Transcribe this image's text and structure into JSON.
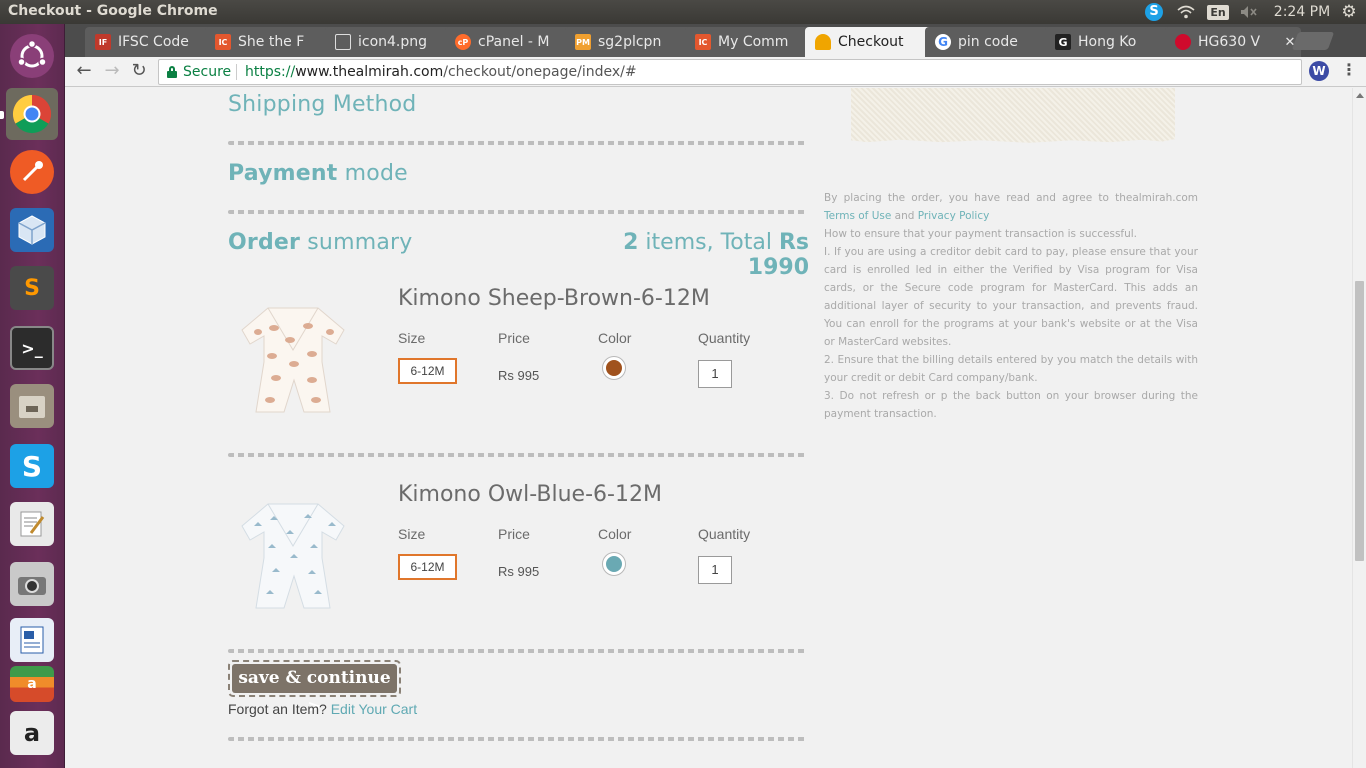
{
  "window": {
    "title": "Checkout - Google Chrome"
  },
  "tray": {
    "skype": "S",
    "lang": "En",
    "clock": "2:24 PM"
  },
  "tabs": [
    {
      "label": "IFSC Code",
      "favicon": "IFSC EPS",
      "color": "#c0392b"
    },
    {
      "label": "She the F",
      "favicon": "ICON",
      "color": "#e4572e"
    },
    {
      "label": "icon4.png",
      "favicon": "doc",
      "color": "#888888"
    },
    {
      "label": "cPanel - M",
      "favicon": "cP",
      "color": "#ff6c2c"
    },
    {
      "label": "sg2plcpn",
      "favicon": "PMA",
      "color": "#f0a030"
    },
    {
      "label": "My Comm",
      "favicon": "ICON",
      "color": "#e4572e"
    },
    {
      "label": "Checkout",
      "favicon": "almirah",
      "color": "#f0a500"
    },
    {
      "label": "pin code",
      "favicon": "G",
      "color": "#4285f4"
    },
    {
      "label": "Hong Ko",
      "favicon": "G",
      "color": "#222222"
    },
    {
      "label": "HG630 V",
      "favicon": "huawei",
      "color": "#cf0a2c"
    }
  ],
  "omnibox": {
    "secure_label": "Secure",
    "url_scheme": "https://",
    "url_host": "www.thealmirah.com",
    "url_path": "/checkout/onepage/index/#"
  },
  "checkout": {
    "shipping_method": "Shipping Method",
    "payment_bold": "Payment",
    "payment_rest": " mode",
    "order_bold": "Order",
    "order_rest": " summary",
    "total_count": "2",
    "total_mid": " items, Total ",
    "total_amount": "Rs 1990",
    "labels": {
      "size": "Size",
      "price": "Price",
      "color": "Color",
      "quantity": "Quantity"
    },
    "products": [
      {
        "name": "Kimono Sheep-Brown-6-12M",
        "size": "6-12M",
        "price": "Rs 995",
        "color": "#a0521d",
        "quantity": "1"
      },
      {
        "name": "Kimono Owl-Blue-6-12M",
        "size": "6-12M",
        "price": "Rs 995",
        "color": "#6aa9b3",
        "quantity": "1"
      }
    ],
    "save_button": "save & continue >",
    "forgot_text": "Forgot an Item? ",
    "edit_cart": "Edit Your Cart"
  },
  "terms": {
    "intro": "By placing the order, you have read and agree to thealmirah.com ",
    "terms_link": "Terms of Use",
    "and": " and ",
    "privacy_link": "Privacy Policy",
    "how_to": "How to ensure that your payment transaction is successful.",
    "point1": "I. If you are using a creditor debit card to pay, please ensure that your card is enrolled led in either the Verified by Visa program for Visa cards, or the Secure code program for MasterCard. This adds an additional layer of security to your transaction, and prevents fraud. You can enroll for the programs at your bank's website or at the Visa or MasterCard websites.",
    "point2": "2. Ensure that the billing details entered by you match the details with your credit or debit Card company/bank.",
    "point3": "3. Do not refresh or p the back button on your browser during the payment transaction."
  }
}
